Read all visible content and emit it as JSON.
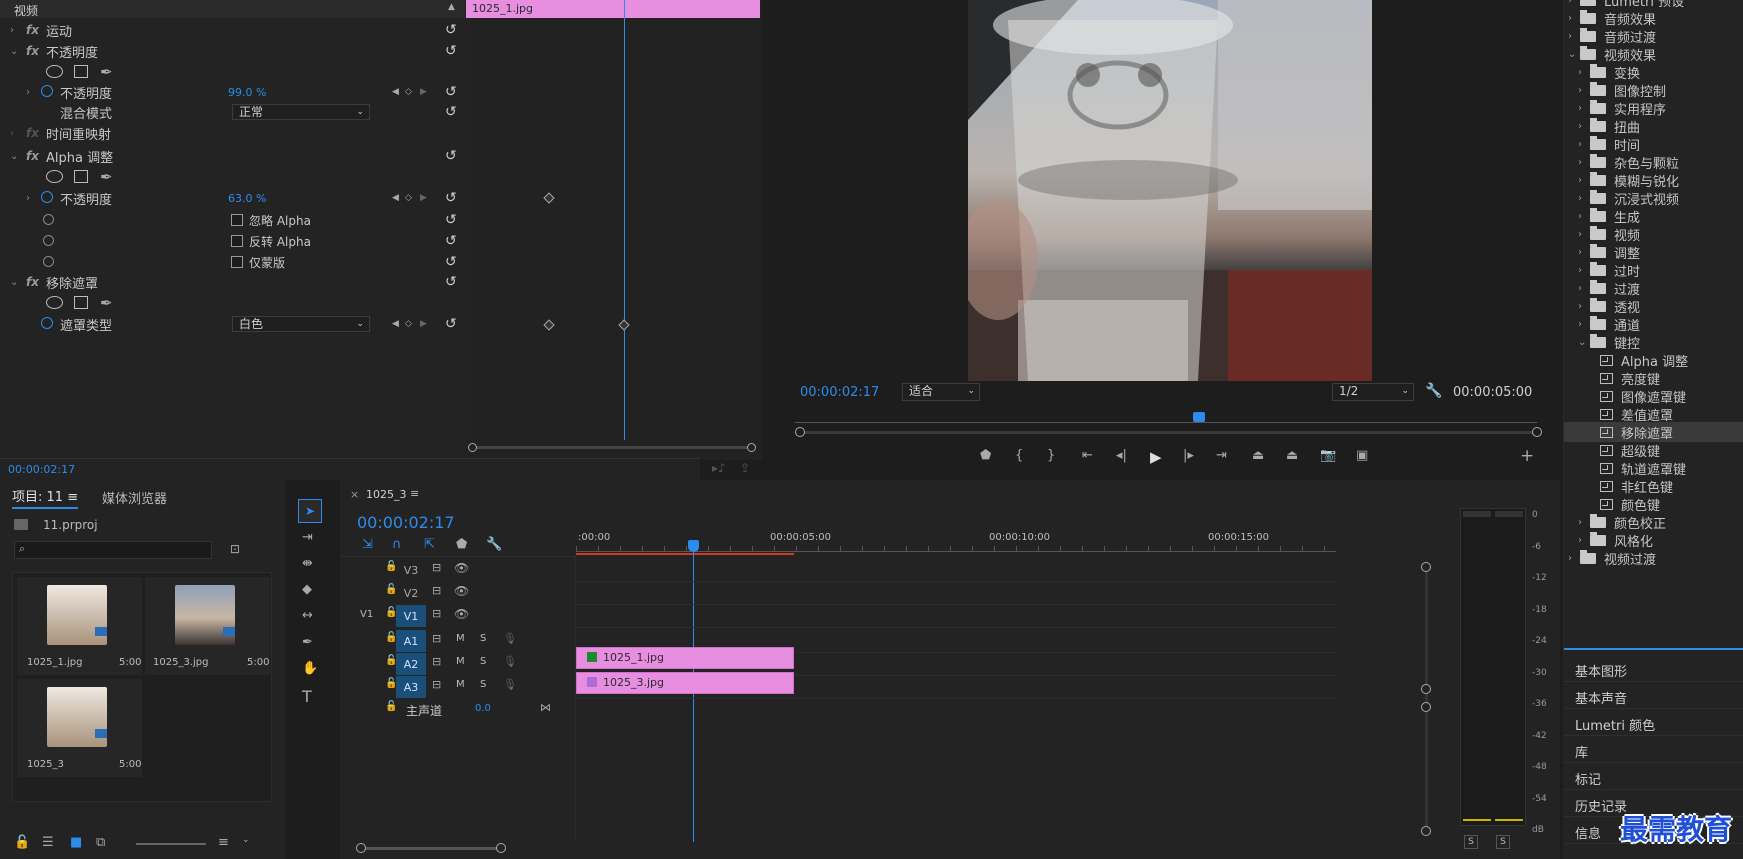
{
  "effect_controls": {
    "section_video": "视频",
    "clip_tab": "1025_1.jpg",
    "motion": "运动",
    "opacity_group": "不透明度",
    "opacity_label": "不透明度",
    "opacity_value": "99.0 %",
    "blend_label": "混合模式",
    "blend_value": "正常",
    "time_remap": "时间重映射",
    "alpha_group": "Alpha 调整",
    "alpha_opacity_label": "不透明度",
    "alpha_opacity_value": "63.0 %",
    "ignore_alpha": "忽略 Alpha",
    "invert_alpha": "反转 Alpha",
    "mask_only": "仅蒙版",
    "remove_matte_group": "移除遮罩",
    "matte_type_label": "遮罩类型",
    "matte_type_value": "白色",
    "timecode": "00:00:02:17"
  },
  "program_monitor": {
    "timecode": "00:00:02:17",
    "fit": "适合",
    "resolution": "1/2",
    "duration": "00:00:05:00"
  },
  "effects_panel": {
    "items": [
      {
        "label": "Lumetri 预设",
        "type": "folder",
        "level": 0
      },
      {
        "label": "音频效果",
        "type": "folder",
        "level": 0
      },
      {
        "label": "音频过渡",
        "type": "folder",
        "level": 0
      },
      {
        "label": "视频效果",
        "type": "folder",
        "level": 0,
        "open": true
      },
      {
        "label": "变换",
        "type": "folder",
        "level": 1
      },
      {
        "label": "图像控制",
        "type": "folder",
        "level": 1
      },
      {
        "label": "实用程序",
        "type": "folder",
        "level": 1
      },
      {
        "label": "扭曲",
        "type": "folder",
        "level": 1
      },
      {
        "label": "时间",
        "type": "folder",
        "level": 1
      },
      {
        "label": "杂色与颗粒",
        "type": "folder",
        "level": 1
      },
      {
        "label": "模糊与锐化",
        "type": "folder",
        "level": 1
      },
      {
        "label": "沉浸式视频",
        "type": "folder",
        "level": 1
      },
      {
        "label": "生成",
        "type": "folder",
        "level": 1
      },
      {
        "label": "视频",
        "type": "folder",
        "level": 1
      },
      {
        "label": "调整",
        "type": "folder",
        "level": 1
      },
      {
        "label": "过时",
        "type": "folder",
        "level": 1
      },
      {
        "label": "过渡",
        "type": "folder",
        "level": 1
      },
      {
        "label": "透视",
        "type": "folder",
        "level": 1
      },
      {
        "label": "通道",
        "type": "folder",
        "level": 1
      },
      {
        "label": "键控",
        "type": "folder",
        "level": 1,
        "open": true
      },
      {
        "label": "Alpha 调整",
        "type": "fx",
        "level": 2
      },
      {
        "label": "亮度键",
        "type": "fx",
        "level": 2
      },
      {
        "label": "图像遮罩键",
        "type": "fx",
        "level": 2
      },
      {
        "label": "差值遮罩",
        "type": "fx",
        "level": 2
      },
      {
        "label": "移除遮罩",
        "type": "fx",
        "level": 2,
        "selected": true
      },
      {
        "label": "超级键",
        "type": "fx",
        "level": 2
      },
      {
        "label": "轨道遮罩键",
        "type": "fx",
        "level": 2
      },
      {
        "label": "非红色键",
        "type": "fx",
        "level": 2
      },
      {
        "label": "颜色键",
        "type": "fx",
        "level": 2
      },
      {
        "label": "颜色校正",
        "type": "folder",
        "level": 1
      },
      {
        "label": "风格化",
        "type": "folder",
        "level": 1
      },
      {
        "label": "视频过渡",
        "type": "folder",
        "level": 0
      }
    ]
  },
  "side_panels": [
    "基本图形",
    "基本声音",
    "Lumetri 颜色",
    "库",
    "标记",
    "历史记录",
    "信息"
  ],
  "project": {
    "tab": "项目: 11",
    "tab2": "媒体浏览器",
    "file": "11.prproj",
    "items": [
      {
        "name": "1025_1.jpg",
        "dur": "5:00"
      },
      {
        "name": "1025_3.jpg",
        "dur": "5:00"
      },
      {
        "name": "1025_3",
        "dur": "5:00"
      }
    ]
  },
  "timeline": {
    "tab": "1025_3",
    "timecode": "00:00:02:17",
    "ruler": [
      ":00:00",
      "00:00:05:00",
      "00:00:10:00",
      "00:00:15:00"
    ],
    "tracks": [
      {
        "name": "V3",
        "src": ""
      },
      {
        "name": "V2",
        "src": ""
      },
      {
        "name": "V1",
        "src": "V1"
      },
      {
        "name": "A1",
        "src": ""
      },
      {
        "name": "A2",
        "src": ""
      },
      {
        "name": "A3",
        "src": ""
      }
    ],
    "master": "主声道",
    "master_val": "0.0",
    "clip_v2": "1025_1.jpg",
    "clip_v1": "1025_3.jpg",
    "m": "M",
    "s": "S"
  },
  "meter": {
    "scale": [
      "0",
      "-6",
      "-12",
      "-18",
      "-24",
      "-30",
      "-36",
      "-42",
      "-48",
      "-54",
      "dB"
    ],
    "solo": "S"
  },
  "watermark": "最需教育"
}
